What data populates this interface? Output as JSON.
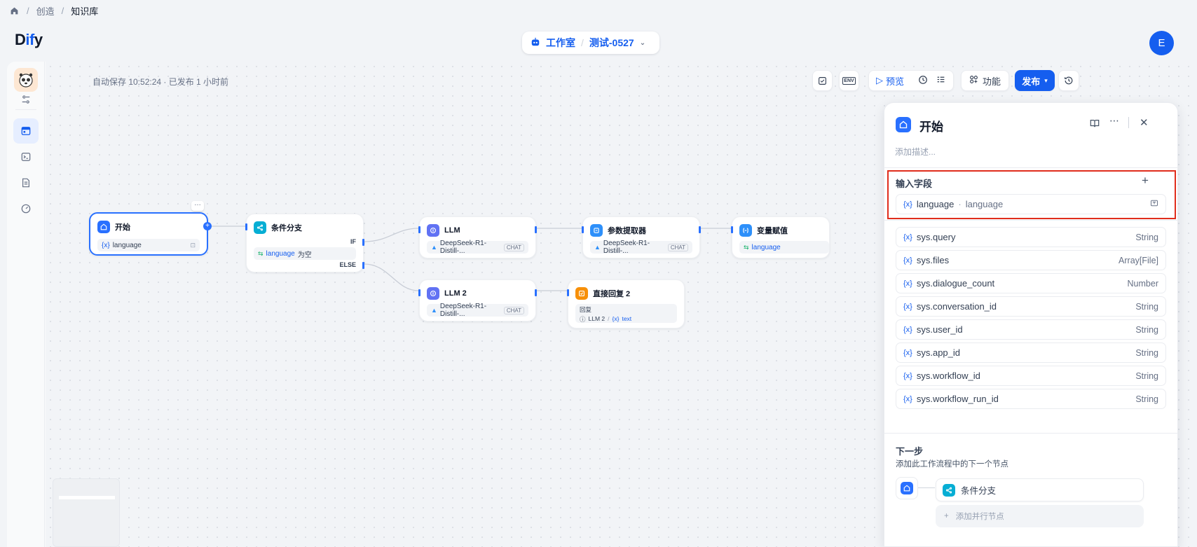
{
  "breadcrumb": {
    "items": [
      "创造",
      "知识库"
    ]
  },
  "header": {
    "logo_part1": "D",
    "logo_part2": "if",
    "logo_part3": "y",
    "studio_label": "工作室",
    "app_name": "测试-0527",
    "user_initial": "E"
  },
  "canvas": {
    "autosave_text": "自动保存 10:52:24 · 已发布 1 小时前"
  },
  "toolbar": {
    "env_label": "ENV",
    "preview_label": "预览",
    "features_label": "功能",
    "publish_label": "发布"
  },
  "nodes": {
    "start": {
      "title": "开始",
      "var": "language"
    },
    "ifelse": {
      "title": "条件分支",
      "if_label": "IF",
      "else_label": "ELSE",
      "cond_var": "language",
      "cond_op": "为空"
    },
    "llm1": {
      "title": "LLM",
      "model": "DeepSeek-R1-Distill-...",
      "mode": "CHAT"
    },
    "llm2": {
      "title": "LLM 2",
      "model": "DeepSeek-R1-Distill-...",
      "mode": "CHAT"
    },
    "param": {
      "title": "参数提取器",
      "model": "DeepSeek-R1-Distill-...",
      "mode": "CHAT"
    },
    "assign": {
      "title": "变量赋值",
      "var": "language"
    },
    "answer": {
      "title": "直接回复 2",
      "label": "回复",
      "ref_node": "LLM 2",
      "ref_var": "text"
    }
  },
  "panel": {
    "title": "开始",
    "desc_placeholder": "添加描述...",
    "input_section_title": "输入字段",
    "input_field": {
      "name": "language",
      "label": "language"
    },
    "sys_vars": [
      {
        "name": "sys.query",
        "type": "String"
      },
      {
        "name": "sys.files",
        "type": "Array[File]"
      },
      {
        "name": "sys.dialogue_count",
        "type": "Number"
      },
      {
        "name": "sys.conversation_id",
        "type": "String"
      },
      {
        "name": "sys.user_id",
        "type": "String"
      },
      {
        "name": "sys.app_id",
        "type": "String"
      },
      {
        "name": "sys.workflow_id",
        "type": "String"
      },
      {
        "name": "sys.workflow_run_id",
        "type": "String"
      }
    ],
    "var_prefix": "{x}",
    "next_step_title": "下一步",
    "next_step_desc": "添加此工作流程中的下一个节点",
    "next_node": "条件分支",
    "add_parallel": "添加并行节点"
  },
  "colors": {
    "accent": "#155eef",
    "highlight": "#e02d1c"
  }
}
